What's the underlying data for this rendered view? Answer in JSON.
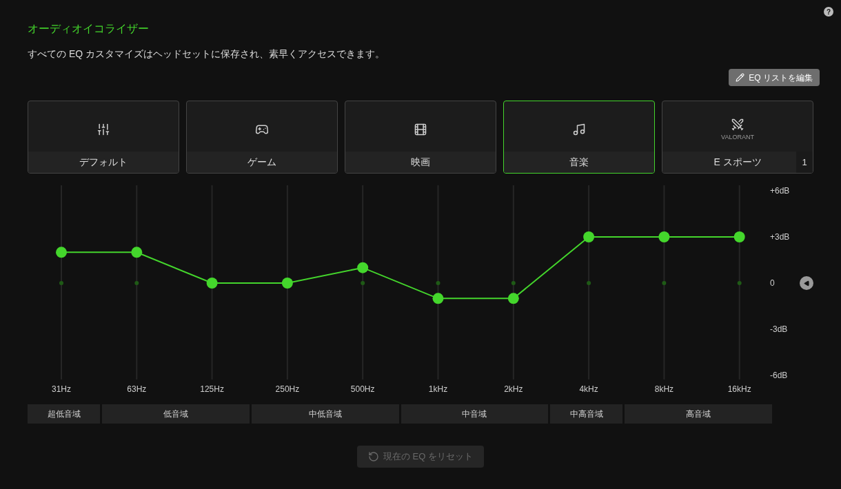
{
  "help_label": "?",
  "title": "オーディオイコライザー",
  "description": "すべての EQ カスタマイズはヘッドセットに保存され、素早くアクセスできます。",
  "edit_button": {
    "label": "EQ リストを編集"
  },
  "presets": [
    {
      "kind": "default",
      "label": "デフォルト",
      "selected": false
    },
    {
      "kind": "game",
      "label": "ゲーム",
      "selected": false
    },
    {
      "kind": "movie",
      "label": "映画",
      "selected": false
    },
    {
      "kind": "music",
      "label": "音楽",
      "selected": true
    },
    {
      "kind": "esports",
      "label": "E スポーツ",
      "selected": false,
      "logo_text": "VALORANT",
      "badge": "1"
    }
  ],
  "equalizer": {
    "chart_data": {
      "type": "line",
      "categories": [
        "31Hz",
        "63Hz",
        "125Hz",
        "250Hz",
        "500Hz",
        "1kHz",
        "2kHz",
        "4kHz",
        "8kHz",
        "16kHz"
      ],
      "series": [
        {
          "color": "#44d62c",
          "marker": true,
          "values": [
            2,
            2,
            0,
            0,
            1,
            -1,
            -1,
            3,
            3,
            3
          ]
        }
      ],
      "grid": true,
      "ylim": [
        -6,
        6
      ],
      "yticks": [
        {
          "value": 6,
          "label": "+6dB"
        },
        {
          "value": 3,
          "label": "+3dB"
        },
        {
          "value": 0,
          "label": "0"
        },
        {
          "value": -3,
          "label": "-3dB"
        },
        {
          "value": -6,
          "label": "-6dB"
        }
      ]
    }
  },
  "ranges": [
    {
      "label": "超低音域",
      "kind": "single"
    },
    {
      "label": "低音域",
      "kind": "double"
    },
    {
      "label": "中低音域",
      "kind": "double"
    },
    {
      "label": "中音域",
      "kind": "double"
    },
    {
      "label": "中高音域",
      "kind": "single"
    },
    {
      "label": "高音域",
      "kind": "double"
    }
  ],
  "reset_button": {
    "label": "現在の EQ をリセット",
    "disabled": true
  }
}
